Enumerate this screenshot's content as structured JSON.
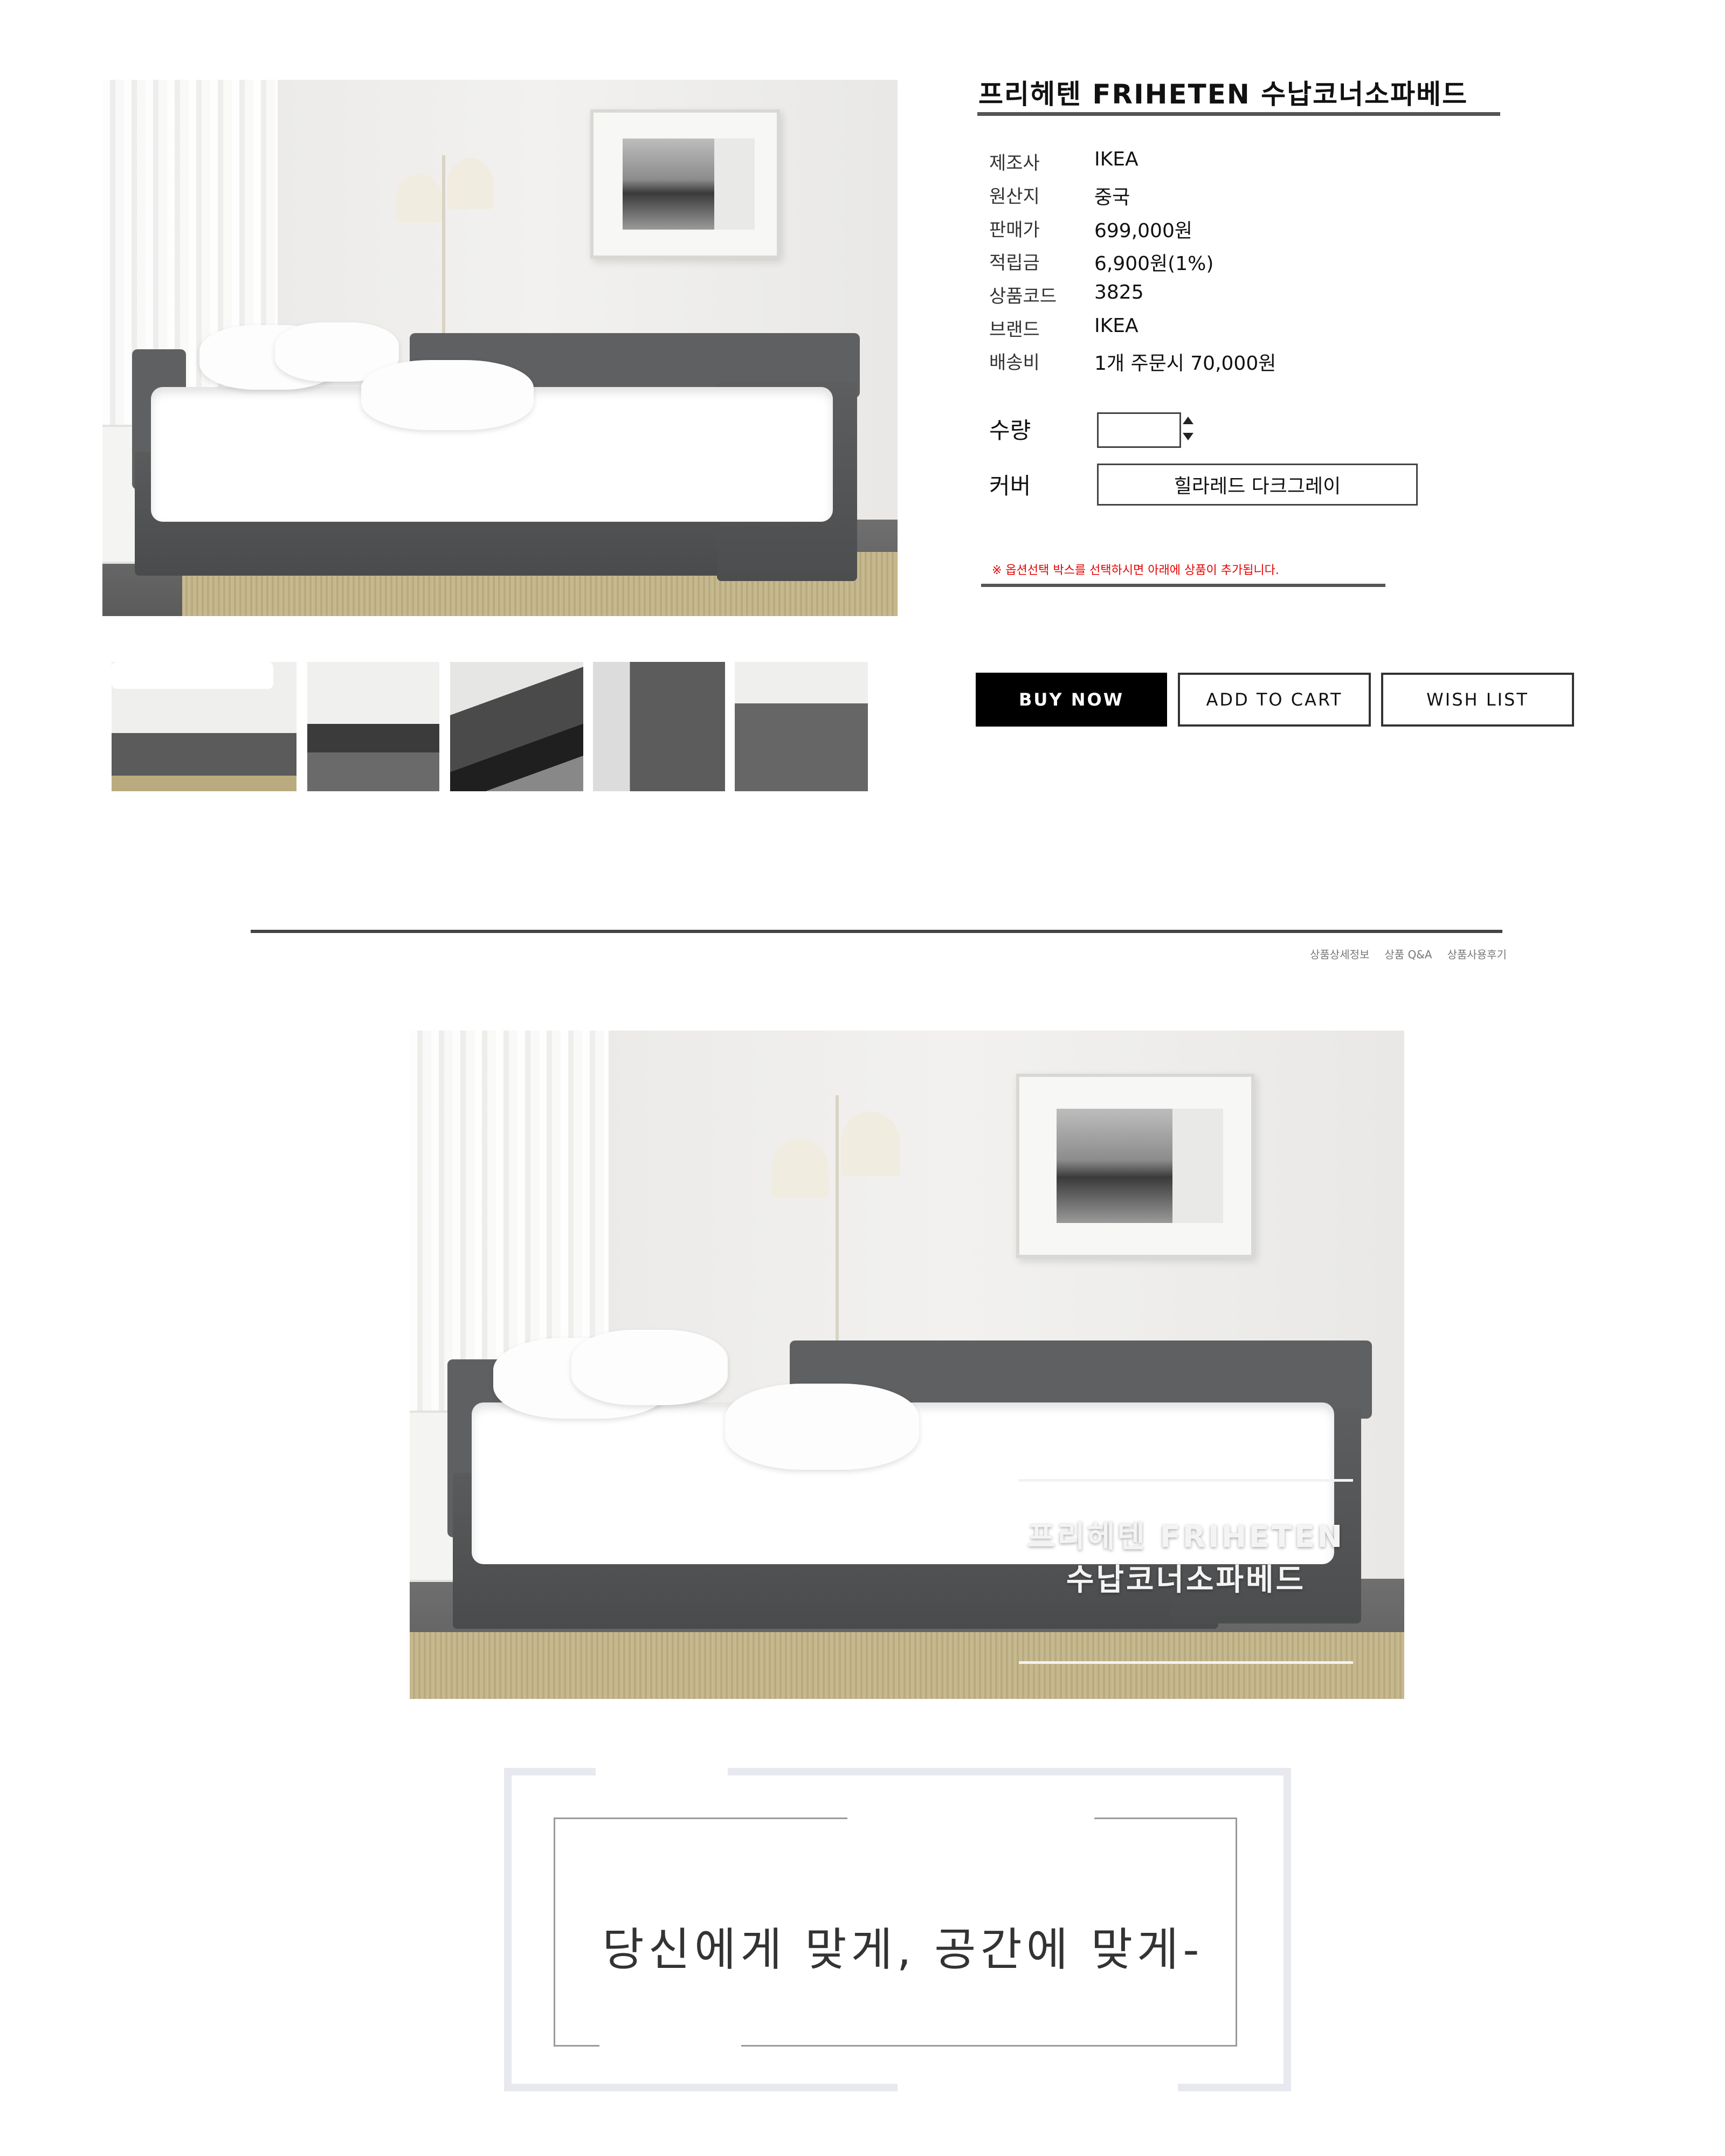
{
  "product": {
    "title": "프리헤텐 FRIHETEN 수납코너소파베드",
    "specs": [
      {
        "label": "제조사",
        "value": "IKEA"
      },
      {
        "label": "원산지",
        "value": "중국"
      },
      {
        "label": "판매가",
        "value": "699,000원"
      },
      {
        "label": "적립금",
        "value": "6,900원(1%)"
      },
      {
        "label": "상품코드",
        "value": "3825"
      },
      {
        "label": "브랜드",
        "value": "IKEA"
      },
      {
        "label": "배송비",
        "value": "1개 주문시 70,000원"
      }
    ]
  },
  "options": {
    "quantity_label": "수량",
    "quantity_value": "",
    "cover_label": "커버",
    "cover_value": "힐라레드 다크그레이",
    "notice": "※ 옵션선택 박스를 선택하시면 아래에 상품이 추가됩니다."
  },
  "buttons": {
    "buy_now": "BUY NOW",
    "add_to_cart": "ADD TO CART",
    "wish_list": "WISH LIST"
  },
  "detail_tabs": [
    "상품상세정보",
    "상품 Q&A",
    "상품사용후기"
  ],
  "banner": {
    "caption_line1": "프리헤텐 FRIHETEN",
    "caption_line2": "수납코너소파베드"
  },
  "tagline": "당신에게 맞게, 공간에 맞게-",
  "colors": {
    "notice_red": "#e60000",
    "buy_button": "#000000",
    "tagline_frame": "#e7e9ee"
  }
}
